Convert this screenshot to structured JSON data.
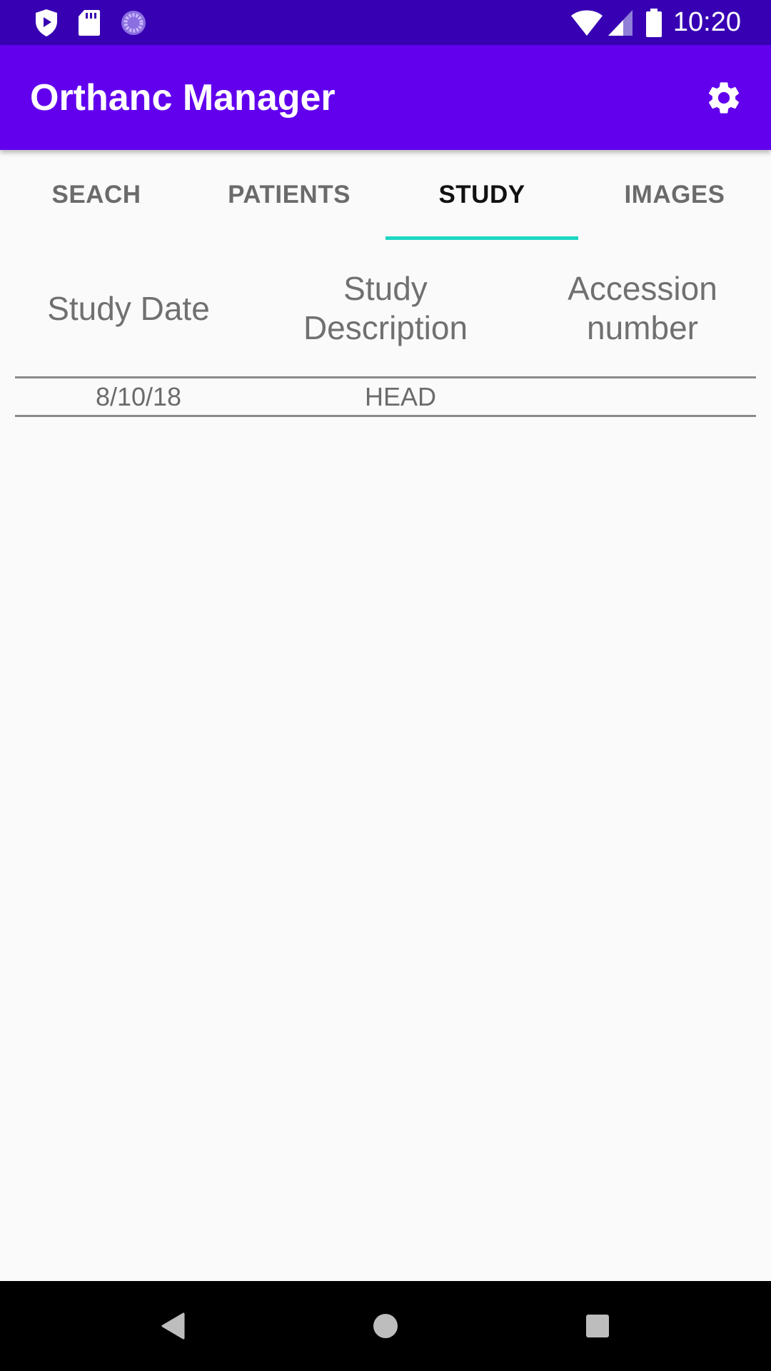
{
  "status_bar": {
    "time": "10:20",
    "left_icons": [
      "shield-play-icon",
      "sd-card-icon",
      "sync-circle-icon"
    ],
    "right_icons": [
      "wifi-icon",
      "cell-signal-icon",
      "battery-icon"
    ]
  },
  "app_bar": {
    "title": "Orthanc Manager",
    "action_icon": "gear-icon"
  },
  "tabs": [
    {
      "label": "SEACH",
      "active": false
    },
    {
      "label": "PATIENTS",
      "active": false
    },
    {
      "label": "STUDY",
      "active": true
    },
    {
      "label": "IMAGES",
      "active": false
    }
  ],
  "table": {
    "headers": {
      "study_date": "Study Date",
      "study_description_line1": "Study",
      "study_description_line2": "Description",
      "accession_line1": "Accession",
      "accession_line2": "number"
    },
    "rows": [
      {
        "study_date": "8/10/18",
        "study_description": "HEAD",
        "accession_number": ""
      }
    ]
  },
  "colors": {
    "status_bar": "#3700b3",
    "app_bar": "#6200ee",
    "tab_indicator": "#1fd6c4",
    "background": "#fafafa"
  }
}
